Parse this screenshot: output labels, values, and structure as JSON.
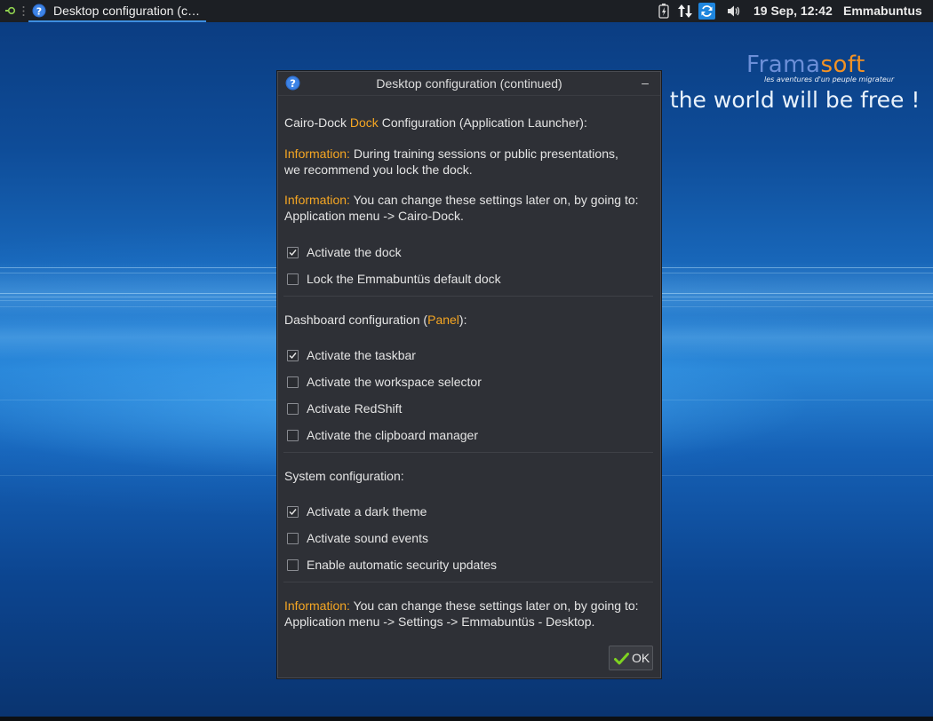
{
  "taskbar": {
    "window_title": "Desktop configuration (c…",
    "clock": "19 Sep, 12:42",
    "user": "Emmabuntus"
  },
  "wallpaper": {
    "logo_part1": "Frama",
    "logo_part2": "soft",
    "tagline": "les aventures d'un peuple migrateur",
    "slogan": ", the world will be free !"
  },
  "dialog": {
    "title": "Desktop configuration (continued)",
    "minimize_label": "–",
    "dock_heading_pre": "Cairo-Dock ",
    "dock_heading_hl": "Dock",
    "dock_heading_post": " Configuration (Application Launcher):",
    "info_label": "Information:",
    "info1_line1": " During training sessions or public presentations,",
    "info1_line2": "we recommend you lock the dock.",
    "info2_line1": " You can change these settings later on, by going to:",
    "info2_line2": "Application menu -> Cairo-Dock.",
    "dock_options": [
      {
        "label": "Activate the dock",
        "checked": true
      },
      {
        "label": "Lock the Emmabuntüs default dock",
        "checked": false
      }
    ],
    "panel_heading_pre": "Dashboard configuration (",
    "panel_heading_hl": "Panel",
    "panel_heading_post": "):",
    "panel_options": [
      {
        "label": "Activate the taskbar",
        "checked": true
      },
      {
        "label": "Activate the workspace selector",
        "checked": false
      },
      {
        "label": "Activate RedShift",
        "checked": false
      },
      {
        "label": "Activate the clipboard manager",
        "checked": false
      }
    ],
    "system_heading": "System configuration:",
    "system_options": [
      {
        "label": "Activate a dark theme",
        "checked": true
      },
      {
        "label": "Activate sound events",
        "checked": false
      },
      {
        "label": "Enable automatic security updates",
        "checked": false
      }
    ],
    "info3_line1": " You can change these settings later on, by going to:",
    "info3_line2": "Application menu -> Settings -> Emmabuntüs - Desktop.",
    "ok_label": "OK"
  },
  "colors": {
    "accent_orange": "#f5a623",
    "dialog_bg": "#2e3036",
    "panel_bg": "#1c1f24"
  },
  "icons": {
    "menu": "whisker-menu-icon",
    "help": "help-question-icon",
    "battery": "battery-icon",
    "network": "network-transfer-icon",
    "update": "software-update-icon",
    "volume": "volume-icon",
    "ok": "checkmark-icon"
  }
}
